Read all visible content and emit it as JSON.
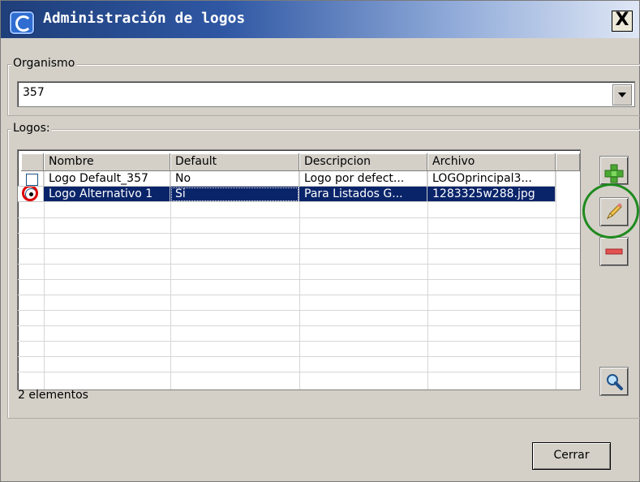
{
  "window": {
    "title": "Administración de logos",
    "close_label": "X"
  },
  "organismo": {
    "legend": "Organismo",
    "selected": "357"
  },
  "logos": {
    "legend": "Logos:",
    "columns": [
      "Nombre",
      "Default",
      "Descripcion",
      "Archivo"
    ],
    "rows": [
      {
        "nombre": "Logo Default_357",
        "default": "No",
        "descripcion": "Logo por defect...",
        "archivo": "LOGOprincipal3...",
        "selected": false
      },
      {
        "nombre": "Logo Alternativo 1",
        "default": "Si",
        "descripcion": "Para Listados G...",
        "archivo": "1283325w288.jpg",
        "selected": true
      }
    ],
    "status": "2 elementos"
  },
  "actions": {
    "add_icon": "plus-icon",
    "edit_icon": "pencil-icon",
    "delete_icon": "minus-icon",
    "search_icon": "magnifier-icon"
  },
  "footer": {
    "close_button": "Cerrar"
  },
  "colors": {
    "selection": "#0a246a",
    "highlight_red": "#dd0000",
    "highlight_green": "#1f8a1f"
  }
}
